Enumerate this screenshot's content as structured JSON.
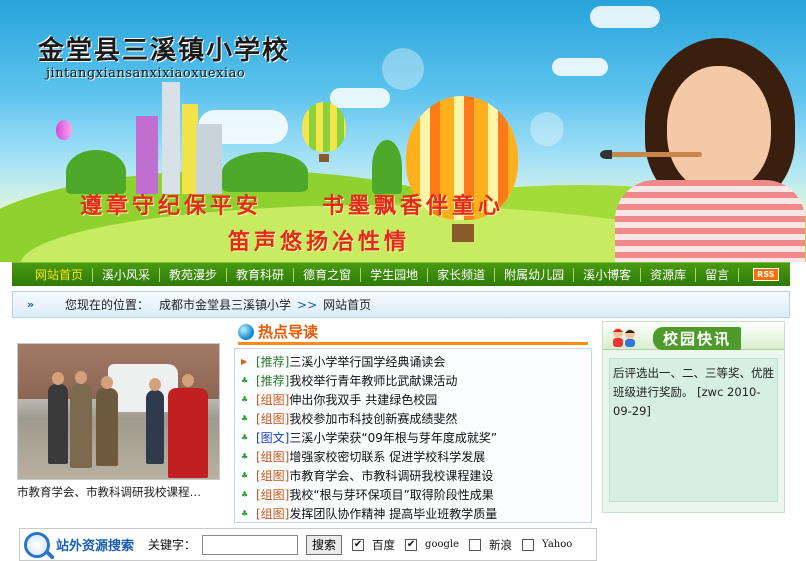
{
  "header": {
    "school_title": "金堂县三溪镇小学校",
    "school_pinyin": "jintangxiansanxixiaoxuexiao",
    "slogans": [
      "遵章守纪保平安",
      "书墨飘香伴童心",
      "笛声悠扬冶性情"
    ]
  },
  "nav": {
    "items": [
      {
        "label": "网站首页",
        "active": true
      },
      {
        "label": "溪小风采"
      },
      {
        "label": "教苑漫步"
      },
      {
        "label": "教育科研"
      },
      {
        "label": "德育之窗"
      },
      {
        "label": "学生园地"
      },
      {
        "label": "家长频道"
      },
      {
        "label": "附属幼儿园"
      },
      {
        "label": "溪小博客"
      },
      {
        "label": "资源库"
      },
      {
        "label": "留言"
      }
    ],
    "rss_label": "RSS"
  },
  "location": {
    "prefix": "您现在的位置：",
    "path": "成都市金堂县三溪镇小学",
    "separator": ">>",
    "current": "网站首页"
  },
  "photo": {
    "caption": "市教育学会、市教科调研我校课程…"
  },
  "hot_news": {
    "title": "热点导读",
    "items": [
      {
        "tag": "[推荐]",
        "text": "三溪小学举行国学经典诵读会",
        "tag_color": "#2d7a2d",
        "bullet": "arrow"
      },
      {
        "tag": "[推荐]",
        "text": "我校举行青年教师比武献课活动",
        "tag_color": "#2d7a2d",
        "bullet": "leaf"
      },
      {
        "tag": "[组图]",
        "text": "伸出你我双手 共建绿色校园",
        "tag_color": "#c8561a",
        "bullet": "leaf"
      },
      {
        "tag": "[组图]",
        "text": "我校参加市科技创新赛成绩斐然",
        "tag_color": "#c8561a",
        "bullet": "leaf"
      },
      {
        "tag": "[图文]",
        "text": "三溪小学荣获“09年根与芽年度成就奖”",
        "tag_color": "#1a3fbf",
        "bullet": "leaf"
      },
      {
        "tag": "[组图]",
        "text": "增强家校密切联系    促进学校科学发展",
        "tag_color": "#c8561a",
        "bullet": "leaf"
      },
      {
        "tag": "[组图]",
        "text": "市教育学会、市教科调研我校课程建设",
        "tag_color": "#c8561a",
        "bullet": "leaf"
      },
      {
        "tag": "[组图]",
        "text": "我校“根与芽环保项目”取得阶段性成果",
        "tag_color": "#c8561a",
        "bullet": "leaf"
      },
      {
        "tag": "[组图]",
        "text": "发挥团队协作精神 提高毕业班教学质量",
        "tag_color": "#c8561a",
        "bullet": "leaf"
      }
    ]
  },
  "campus_news": {
    "title": "校园快讯",
    "text": "后评选出一、二、三等奖、优胜班级进行奖励。 [zwc 2010-09-29]"
  },
  "search": {
    "brand": "站外资源搜索",
    "keyword_label": "关键字：",
    "keyword_value": "",
    "button_label": "搜索",
    "engines": [
      {
        "label": "百度",
        "checked": true
      },
      {
        "label": "google",
        "checked": true
      },
      {
        "label": "新浪",
        "checked": false
      },
      {
        "label": "Yahoo",
        "checked": false
      }
    ]
  },
  "colors": {
    "nav_bg": "#3a8a0c",
    "nav_active": "#ffe600",
    "hot_title": "#e85a00",
    "slogan": "#e32b1b"
  }
}
